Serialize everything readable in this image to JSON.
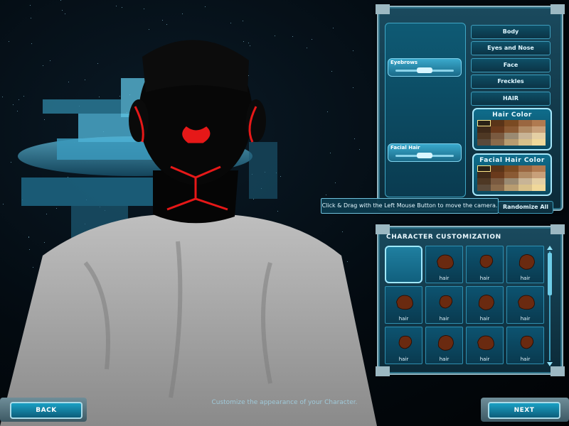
{
  "sliders": [
    {
      "label": "Eyebrows",
      "value": 0.5
    },
    {
      "label": "Facial Hair",
      "value": 0.5
    }
  ],
  "categories": [
    "Body",
    "Eyes and Nose",
    "Face",
    "Freckles",
    "HAIR"
  ],
  "hair_color": {
    "title": "Hair Color",
    "swatches": [
      "#2a2217",
      "#5a3418",
      "#7a4a22",
      "#9a6640",
      "#b07a50",
      "#3e2a1a",
      "#6a3a1c",
      "#8a5a34",
      "#b08a64",
      "#c8a07a",
      "#4e3824",
      "#7a5a40",
      "#9a8a72",
      "#c8b496",
      "#e4cfa4",
      "#5a4a3a",
      "#8a6a4a",
      "#b89c70",
      "#d8c08a",
      "#f0d89a"
    ],
    "selected_index": 0
  },
  "facial_hair_color": {
    "title": "Facial Hair Color",
    "swatches": [
      "#2a2217",
      "#5a3418",
      "#7a4a22",
      "#9a6640",
      "#b07a50",
      "#3e2a1a",
      "#6a3a1c",
      "#8a5a34",
      "#b08a64",
      "#c8a07a",
      "#4e3824",
      "#7a5a40",
      "#9a8a72",
      "#c8b496",
      "#e4cfa4",
      "#5a4a3a",
      "#8a6a4a",
      "#b89c70",
      "#d8c08a",
      "#f0d89a"
    ],
    "selected_index": 0
  },
  "tooltip": "Click & Drag with the Left Mouse Button to move the camera.",
  "randomize_label": "Randomize All",
  "customization": {
    "title": "CHARACTER CUSTOMIZATION",
    "items": [
      {
        "label": ""
      },
      {
        "label": "hair"
      },
      {
        "label": "hair"
      },
      {
        "label": "hair"
      },
      {
        "label": "hair"
      },
      {
        "label": "hair"
      },
      {
        "label": "hair"
      },
      {
        "label": "hair"
      },
      {
        "label": "hair"
      },
      {
        "label": "hair"
      },
      {
        "label": "hair"
      },
      {
        "label": "hair"
      }
    ]
  },
  "back_label": "BACK",
  "next_label": "NEXT",
  "footer": "Customize the appearance of your Character.",
  "colors": {
    "accent": "#1aa0c4",
    "hair": "#6a2a10",
    "tattoo": "#ff1a1a"
  }
}
